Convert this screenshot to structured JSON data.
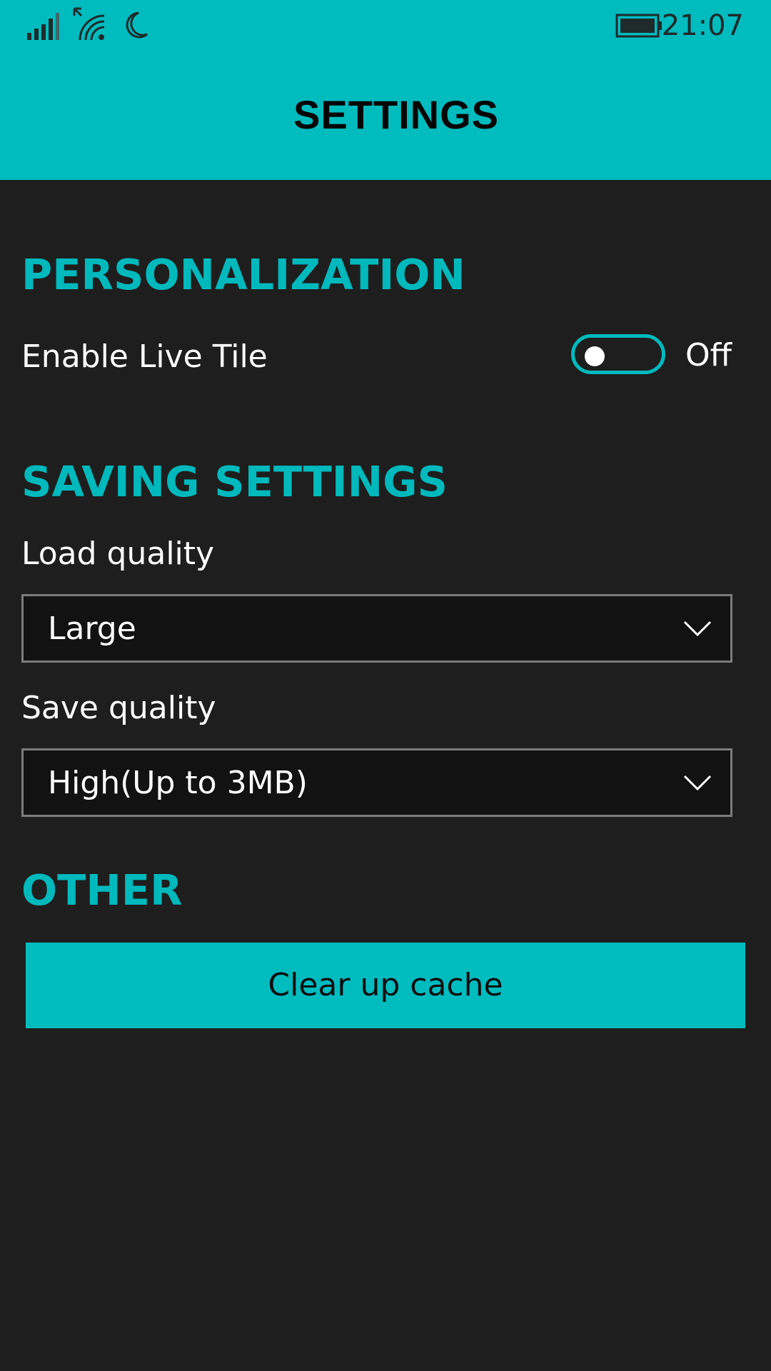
{
  "colors": {
    "accent": "#00bcbf",
    "background": "#1e1e1e",
    "select_background": "#121212",
    "select_border": "#7b7b7b"
  },
  "status_bar": {
    "time": "21:07",
    "icons": [
      "signal-strength-icon",
      "wifi-icon",
      "moon-icon",
      "battery-icon"
    ]
  },
  "header": {
    "title": "SETTINGS"
  },
  "sections": {
    "personalization": {
      "title": "PERSONALIZATION",
      "live_tile": {
        "label": "Enable Live Tile",
        "state": "Off",
        "enabled": false
      }
    },
    "saving": {
      "title": "SAVING SETTINGS",
      "load_quality": {
        "label": "Load quality",
        "value": "Large",
        "icon": "chevron-down-icon"
      },
      "save_quality": {
        "label": "Save quality",
        "value": "High(Up to 3MB)",
        "icon": "chevron-down-icon"
      }
    },
    "other": {
      "title": "OTHER",
      "clear_cache_label": "Clear up cache"
    }
  }
}
